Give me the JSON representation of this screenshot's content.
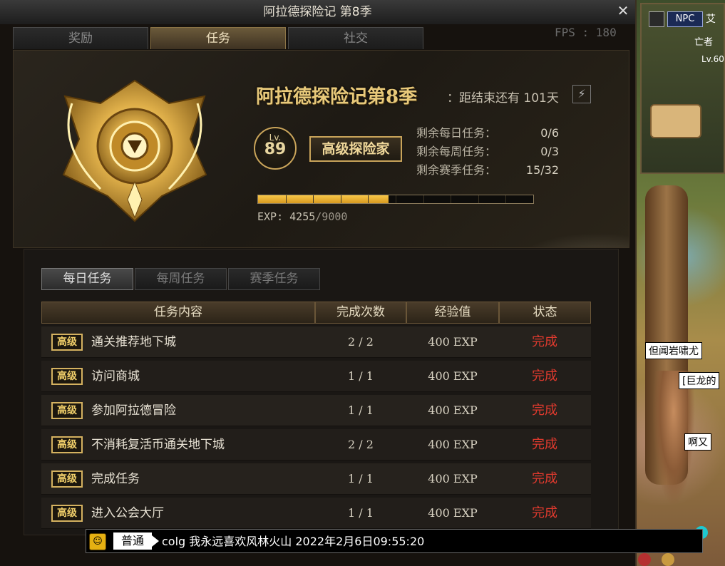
{
  "window": {
    "title": "阿拉德探险记 第8季",
    "close_label": "✕",
    "fps": "FPS : 180"
  },
  "main_tabs": [
    {
      "label": "奖励",
      "active": false
    },
    {
      "label": "任务",
      "active": true
    },
    {
      "label": "社交",
      "active": false
    }
  ],
  "header": {
    "season_title": "阿拉德探险记第8季",
    "time_left": "：距结束还有 101天",
    "level_label": "Lv.",
    "level": "89",
    "rank": "高级探险家",
    "remaining": [
      {
        "label": "剩余每日任务：",
        "value": "0/6"
      },
      {
        "label": "剩余每周任务：",
        "value": "0/3"
      },
      {
        "label": "剩余赛季任务：",
        "value": "15/32"
      }
    ],
    "exp_label": "EXP:",
    "exp_current": "4255",
    "exp_max": "/9000",
    "exp_progress": 0.4728
  },
  "sub_tabs": [
    {
      "label": "每日任务",
      "active": true
    },
    {
      "label": "每周任务",
      "active": false
    },
    {
      "label": "赛季任务",
      "active": false
    }
  ],
  "table": {
    "headers": [
      "任务内容",
      "完成次数",
      "经验值",
      "状态"
    ],
    "rows": [
      {
        "tag": "高级",
        "name": "通关推荐地下城",
        "count": "2 / 2",
        "exp": "400 EXP",
        "status": "完成"
      },
      {
        "tag": "高级",
        "name": "访问商城",
        "count": "1 / 1",
        "exp": "400 EXP",
        "status": "完成"
      },
      {
        "tag": "高级",
        "name": "参加阿拉德冒险",
        "count": "1 / 1",
        "exp": "400 EXP",
        "status": "完成"
      },
      {
        "tag": "高级",
        "name": "不消耗复活币通关地下城",
        "count": "2 / 2",
        "exp": "400 EXP",
        "status": "完成"
      },
      {
        "tag": "高级",
        "name": "完成任务",
        "count": "1 / 1",
        "exp": "400 EXP",
        "status": "完成"
      },
      {
        "tag": "高级",
        "name": "进入公会大厅",
        "count": "1 / 1",
        "exp": "400 EXP",
        "status": "完成"
      }
    ]
  },
  "chat": {
    "channel": "普通",
    "message": "colg 我永远喜欢风林火山 2022年2月6日09:55:20"
  },
  "minimap": {
    "npc_label": "NPC",
    "name_top": "艾",
    "name_sub": "亡者",
    "level": "Lv.60"
  },
  "bubbles": {
    "b1": "但闻岩啸尤",
    "b2": "[巨龙的",
    "b3": "啊又"
  }
}
